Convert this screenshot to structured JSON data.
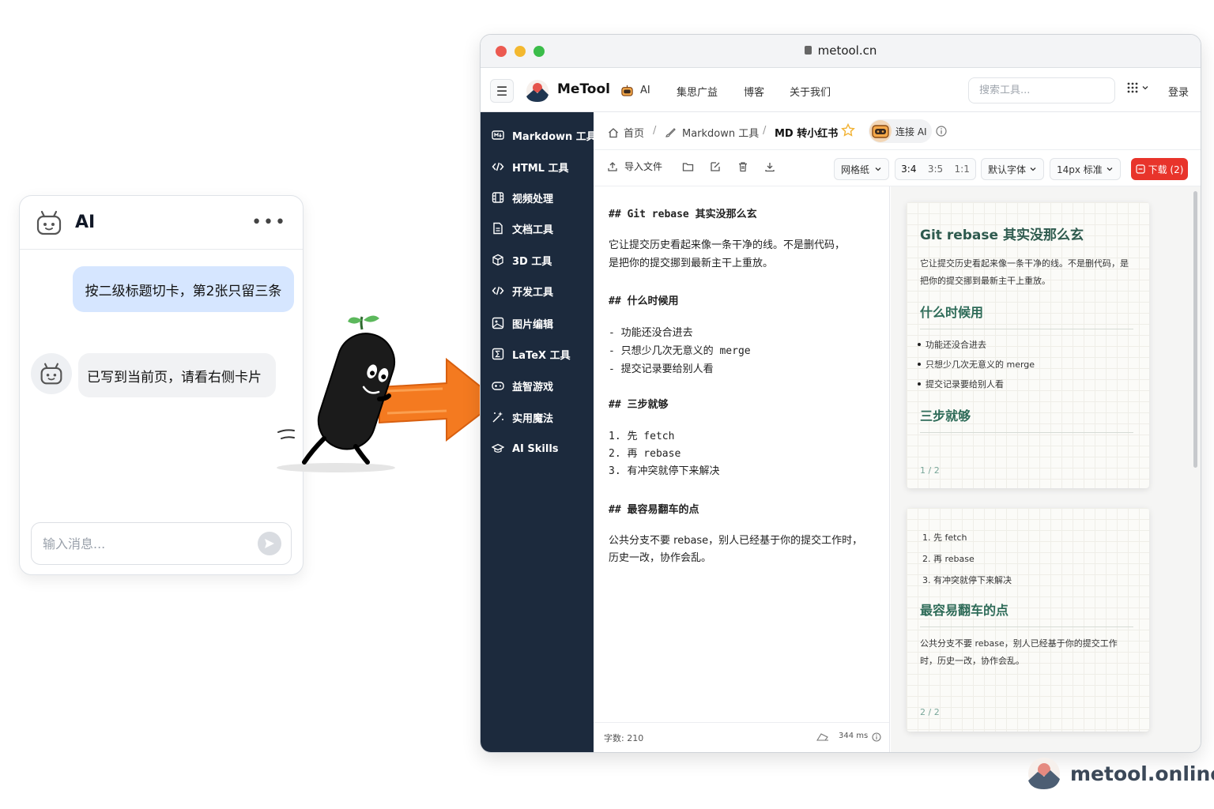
{
  "chat": {
    "title": "AI",
    "more": "•••",
    "user_message": "按二级标题切卡，第2张只留三条",
    "ai_message": "已写到当前页，请看右侧卡片",
    "input_placeholder": "输入消息..."
  },
  "browser": {
    "url": "metool.cn",
    "brand": "MeTool",
    "nav": [
      "AI",
      "集思广益",
      "博客",
      "关于我们"
    ],
    "search_placeholder": "搜索工具...",
    "login": "登录"
  },
  "sidebar": {
    "items": [
      "Markdown 工具",
      "HTML 工具",
      "视频处理",
      "文档工具",
      "3D 工具",
      "开发工具",
      "图片编辑",
      "LaTeX 工具",
      "益智游戏",
      "实用魔法",
      "AI Skills"
    ]
  },
  "breadcrumb": {
    "home": "首页",
    "section": "Markdown 工具",
    "current": "MD 转小红书",
    "separator": "/",
    "connect_ai": "连接 AI"
  },
  "toolbar": {
    "import": "导入文件",
    "background": "网格纸",
    "ratios": [
      "3:4",
      "3:5",
      "1:1"
    ],
    "font": "默认字体",
    "size": "14px 标准",
    "download": "下载 (2)"
  },
  "editor": {
    "h_title": "## Git rebase 其实没那么玄",
    "p1_line1": "它让提交历史看起来像一条干净的线。不是删代码，",
    "p1_line2": "是把你的提交挪到最新主干上重放。",
    "h_when": "## 什么时候用",
    "when_items": [
      "- 功能还没合进去",
      "- 只想少几次无意义的 merge",
      "- 提交记录要给别人看"
    ],
    "h_steps": "## 三步就够",
    "steps": [
      "1. 先 fetch",
      "2. 再 rebase",
      "3. 有冲突就停下来解决"
    ],
    "h_pitfall": "## 最容易翻车的点",
    "p2_line1": "公共分支不要 rebase，别人已经基于你的提交工作时，",
    "p2_line2": "历史一改，协作会乱。",
    "word_count": "字数: 210",
    "render_time": "344 ms"
  },
  "cards": [
    {
      "title": "Git rebase 其实没那么玄",
      "paragraph": "它让提交历史看起来像一条干净的线。不是删代码，是把你的提交挪到最新主干上重放。",
      "h_when": "什么时候用",
      "items": [
        "功能还没合进去",
        "只想少几次无意义的 merge",
        "提交记录要给别人看"
      ],
      "h_steps": "三步就够",
      "page": "1 / 2"
    },
    {
      "steps": [
        "1. 先 fetch",
        "2. 再 rebase",
        "3. 有冲突就停下来解决"
      ],
      "h_pitfall": "最容易翻车的点",
      "paragraph": "公共分支不要 rebase，别人已经基于你的提交工作时，历史一改，协作会乱。",
      "page": "2 / 2"
    }
  ],
  "footer": {
    "brand": "metool.online"
  },
  "colors": {
    "sidebar": "#1c2a3d",
    "accent_red": "#e8342b",
    "user_bubble": "#d6e6ff",
    "arrow": "#f47a20",
    "card_heading": "#2e6b58"
  }
}
